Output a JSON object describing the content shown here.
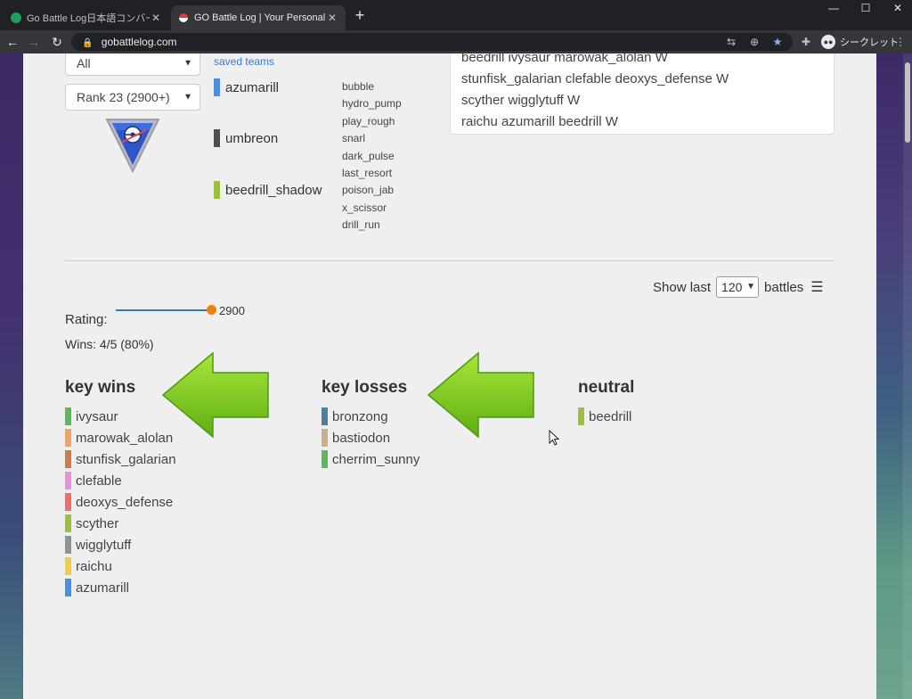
{
  "browser": {
    "tabs": [
      {
        "title": "Go Battle Log日本語コンバーター",
        "active": false
      },
      {
        "title": "GO Battle Log | Your Personal Ba",
        "active": true
      }
    ],
    "url": "gobattlelog.com",
    "profile_label": "シークレット"
  },
  "controls": {
    "filter_value": "All",
    "rank_value": "Rank 23 (2900+)",
    "saved_teams_link": "saved teams"
  },
  "team": [
    {
      "name": "azumarill",
      "color": "#4a90e2"
    },
    {
      "name": "umbreon",
      "color": "#4d4d52"
    },
    {
      "name": "beedrill_shadow",
      "color": "#9bc13c"
    }
  ],
  "moves": [
    "bubble",
    "hydro_pump",
    "play_rough",
    "snarl",
    "dark_pulse",
    "last_resort",
    "poison_jab",
    "x_scissor",
    "drill_run"
  ],
  "battle_log": [
    "beedrill ivysaur marowak_alolan W",
    "stunfisk_galarian clefable deoxys_defense W",
    "scyther wigglytuff W",
    "raichu azumarill beedrill W"
  ],
  "show_last": {
    "prefix": "Show last",
    "value": "120",
    "suffix": "battles"
  },
  "stats": {
    "rating_label": "Rating:",
    "rating_value": "2900",
    "wins": "Wins: 4/5 (80%)"
  },
  "key_wins": {
    "heading": "key wins",
    "items": [
      {
        "name": "ivysaur",
        "color": "#5cb85c"
      },
      {
        "name": "marowak_alolan",
        "color": "#f4a460"
      },
      {
        "name": "stunfisk_galarian",
        "color": "#d2784a"
      },
      {
        "name": "clefable",
        "color": "#e890e0"
      },
      {
        "name": "deoxys_defense",
        "color": "#f06b6b"
      },
      {
        "name": "scyther",
        "color": "#9bc13c"
      },
      {
        "name": "wigglytuff",
        "color": "#8e9399"
      },
      {
        "name": "raichu",
        "color": "#f0d040"
      },
      {
        "name": "azumarill",
        "color": "#4a90e2"
      }
    ]
  },
  "key_losses": {
    "heading": "key losses",
    "items": [
      {
        "name": "bronzong",
        "color": "#4f7fa0"
      },
      {
        "name": "bastiodon",
        "color": "#c8b08a"
      },
      {
        "name": "cherrim_sunny",
        "color": "#5cb85c"
      }
    ]
  },
  "neutral": {
    "heading": "neutral",
    "items": [
      {
        "name": "beedrill",
        "color": "#9bc13c"
      }
    ]
  }
}
